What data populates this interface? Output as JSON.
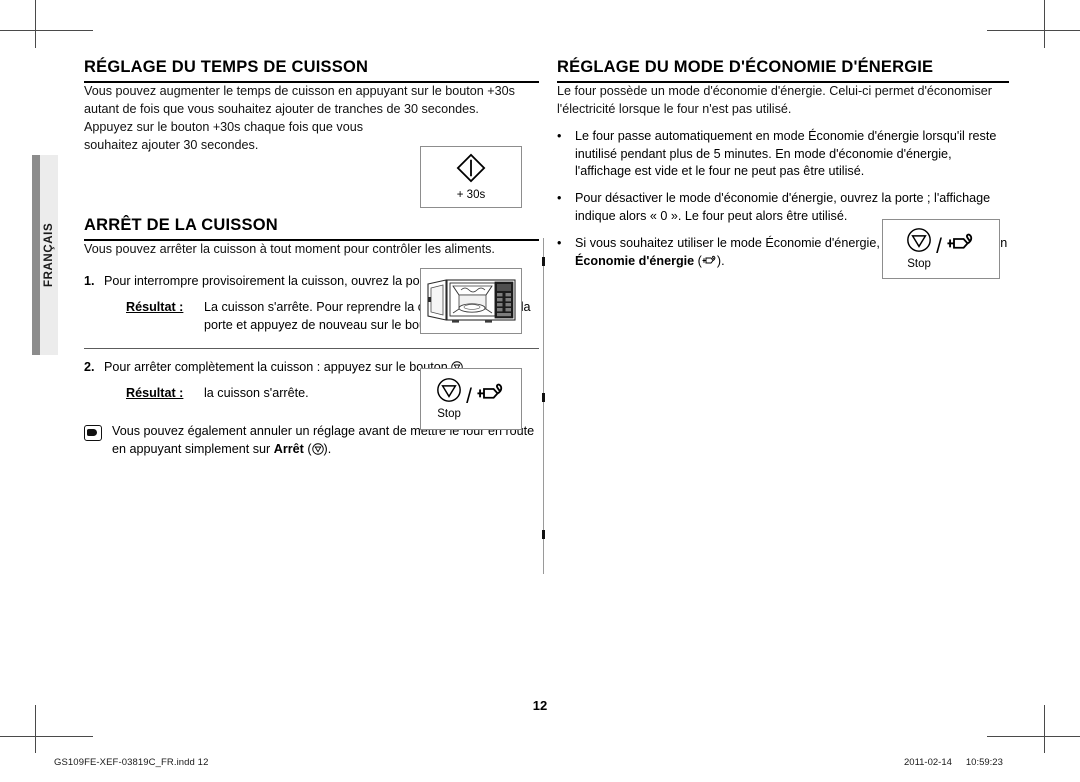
{
  "page": {
    "language_tab": "FRANÇAIS",
    "page_number": "12"
  },
  "left_column": {
    "section1": {
      "title": "RÉGLAGE DU TEMPS DE CUISSON",
      "paragraph1": "Vous pouvez augmenter le temps de cuisson en appuyant sur le bouton +30s autant de fois que vous souhaitez ajouter de tranches de 30 secondes.",
      "paragraph2": "Appuyez sur le bouton +30s chaque fois que vous souhaitez ajouter 30 secondes.",
      "button_box": {
        "icon": "start-diamond-icon",
        "caption": "+ 30s"
      }
    },
    "section2": {
      "title": "ARRÊT DE LA CUISSON",
      "intro": "Vous pouvez arrêter la cuisson à tout moment pour contrôler les aliments.",
      "steps": [
        {
          "number": "1.",
          "text": "Pour interrompre provisoirement la cuisson, ouvrez la porte.",
          "result_label": "Résultat :",
          "result_text_part1": "La cuisson s'arrête. Pour reprendre la cuisson, refermez la porte et appuyez de nouveau sur le bouton ",
          "result_text_part2": "."
        },
        {
          "number": "2.",
          "text_part1": "Pour arrêter complètement la cuisson : appuyez sur le bouton ",
          "text_part2": ".",
          "result_label": "Résultat :",
          "result_text": "la cuisson s'arrête."
        }
      ],
      "oven_box": {
        "icon": "microwave-oven-open-door-image"
      },
      "stop_box": {
        "stop_icon": "stop-triangle-icon",
        "stop_label": "Stop",
        "separator": "/",
        "eco_icon": "energy-save-plug-icon"
      },
      "note": {
        "icon": "pointing-hand-icon",
        "text_part1": "Vous pouvez également annuler un réglage avant de mettre le four en route en appuyant simplement sur ",
        "bold_word": "Arrêt",
        "text_part2": " (",
        "text_part3": ")."
      }
    }
  },
  "right_column": {
    "section": {
      "title": "RÉGLAGE DU MODE D'ÉCONOMIE D'ÉNERGIE",
      "intro": "Le four possède un mode d'économie d'énergie. Celui-ci permet d'économiser l'électricité lorsque le four n'est pas utilisé.",
      "bullets": [
        {
          "marker": "•",
          "text": "Le four passe automatiquement en mode Économie d'énergie lorsqu'il reste inutilisé pendant plus de 5 minutes. En mode d'économie d'énergie, l'affichage est vide et le four ne peut pas être utilisé."
        },
        {
          "marker": "•",
          "text": "Pour désactiver le mode d'économie d'énergie, ouvrez la porte ; l'affichage indique alors « 0 ». Le four peut alors être utilisé."
        },
        {
          "marker": "•",
          "text_part1": "Si vous souhaitez utiliser le mode Économie d'énergie, appuyez sur le bouton ",
          "bold_phrase": "Économie d'énergie",
          "text_part2": " (",
          "text_part3": ")."
        }
      ],
      "stop_box": {
        "stop_icon": "stop-triangle-icon",
        "stop_label": "Stop",
        "separator": "/",
        "eco_icon": "energy-save-plug-icon"
      }
    }
  },
  "footer": {
    "file_name": "GS109FE-XEF-03819C_FR.indd   12",
    "date": "2011-02-14",
    "time": "10:59:23"
  }
}
